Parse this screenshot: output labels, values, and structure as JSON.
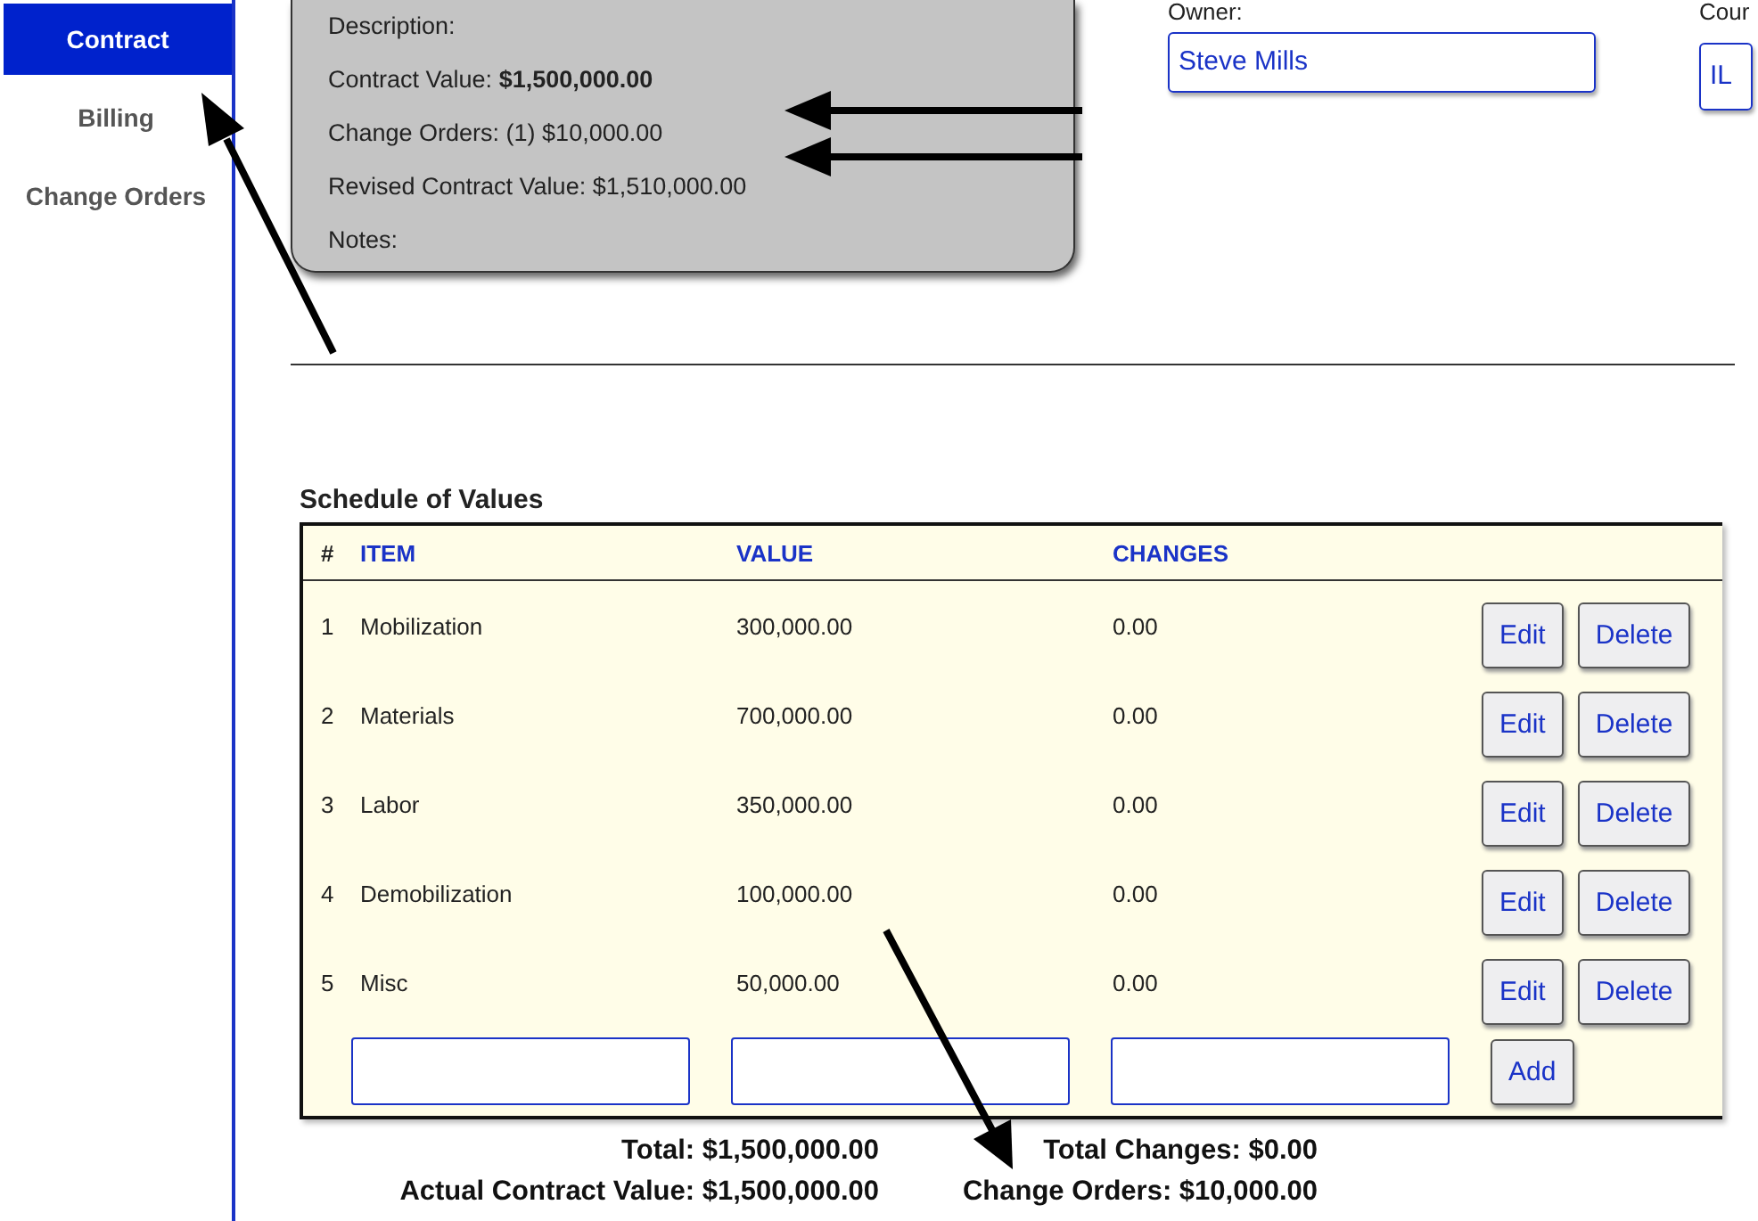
{
  "sidebar": {
    "items": [
      {
        "label": "Contract",
        "selected": true
      },
      {
        "label": "Billing",
        "selected": false
      },
      {
        "label": "Change Orders",
        "selected": false
      }
    ]
  },
  "contract_card": {
    "lines": [
      "Description:",
      "Contract Value: **$1,500,000.00**",
      "Change Orders: (1) $10,000.00",
      "Revised Contract Value: $1,510,000.00",
      "Notes:"
    ]
  },
  "owner": {
    "label": "Owner:",
    "value": "Steve Mills"
  },
  "country": {
    "label": "Cour",
    "value": "IL"
  },
  "schedule": {
    "title": "Schedule of Values",
    "columns": [
      "#",
      "ITEM",
      "VALUE",
      "CHANGES"
    ],
    "rows": [
      {
        "number": "1",
        "item": "Mobilization",
        "value": "300,000.00",
        "changes": "0.00",
        "edit": "Edit",
        "delete": "Delete"
      },
      {
        "number": "2",
        "item": "Materials",
        "value": "700,000.00",
        "changes": "0.00",
        "edit": "Edit",
        "delete": "Delete"
      },
      {
        "number": "3",
        "item": "Labor",
        "value": "350,000.00",
        "changes": "0.00",
        "edit": "Edit",
        "delete": "Delete"
      },
      {
        "number": "4",
        "item": "Demobilization",
        "value": "100,000.00",
        "changes": "0.00",
        "edit": "Edit",
        "delete": "Delete"
      },
      {
        "number": "5",
        "item": "Misc",
        "value": "50,000.00",
        "changes": "0.00",
        "edit": "Edit",
        "delete": "Delete"
      }
    ],
    "add_button": "Add"
  },
  "totals": {
    "left": [
      "Total: $1,500,000.00",
      "Actual Contract Value: $1,500,000.00"
    ],
    "right": [
      "Total Changes: $0.00",
      "Change Orders: $10,000.00"
    ]
  }
}
